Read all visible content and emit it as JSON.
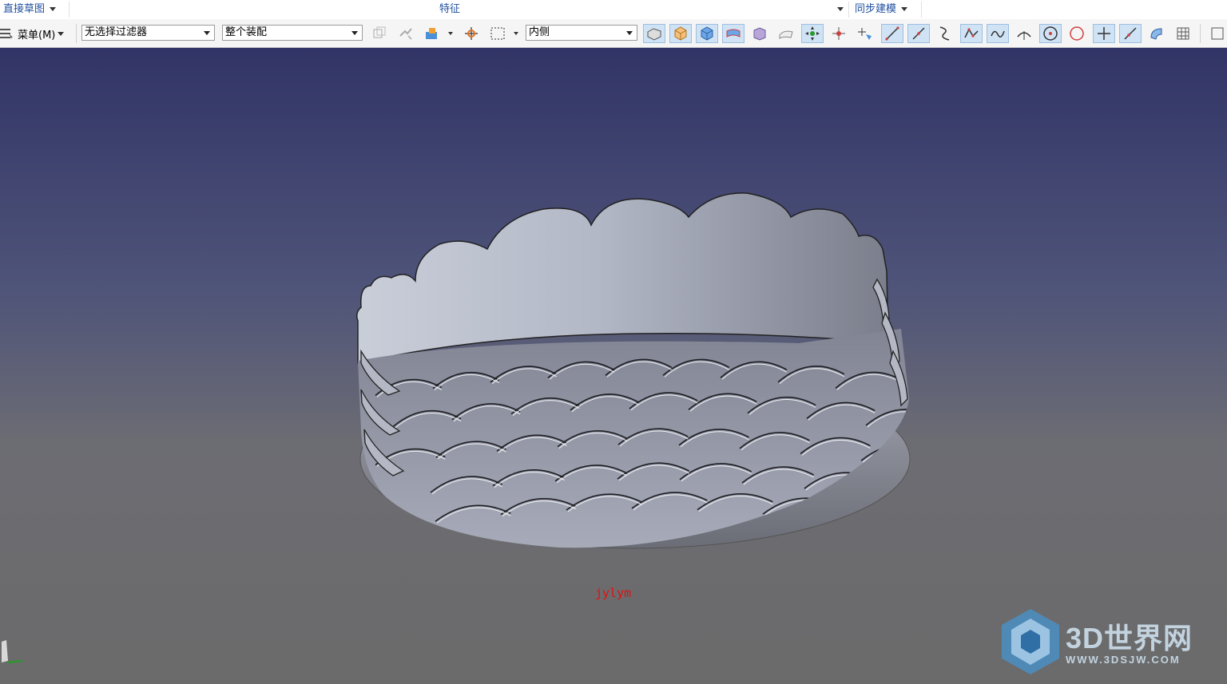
{
  "ribbon_groups": {
    "direct_sketch": "直接草图",
    "feature": "特征",
    "sync_modeling": "同步建模"
  },
  "toolbar": {
    "menu_label": "菜单(M)",
    "filter_value": "无选择过滤器",
    "assembly_scope_value": "整个装配",
    "inside_value": "内侧"
  },
  "icons": [
    "menu-icon",
    "assembly-feature-icon",
    "move-component-icon",
    "create-feature-icon",
    "snap-point-icon",
    "select-box-icon",
    "solid-face-icon",
    "body-icon",
    "face-icon",
    "sheet-body-icon",
    "block-icon",
    "surface-icon",
    "select-all-icon",
    "point-on-curve-icon",
    "selection-intent-icon",
    "line-icon",
    "line-segment-icon",
    "curve-icon",
    "polyline-icon",
    "spline-icon",
    "arc-icon",
    "circle-center-icon",
    "circle-icon",
    "plus-icon",
    "tangent-line-icon",
    "surface-edge-icon",
    "grid-icon"
  ],
  "viewport": {
    "annotation": "jylym",
    "background_top": "#313466",
    "background_bottom": "#6b6b6b"
  },
  "watermark": {
    "title": "3D世界网",
    "url": "WWW.3DSJW.COM"
  }
}
